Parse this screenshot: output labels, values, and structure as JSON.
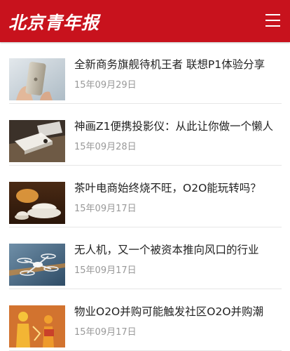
{
  "header": {
    "logo_text": "北京青年报",
    "menu_icon": "hamburger-menu-icon",
    "background_color": "#c8121d"
  },
  "articles": [
    {
      "title": "全新商务旗舰待机王者 联想P1体验分享",
      "date": "15年09月29日",
      "thumb": "phone-in-hand-image"
    },
    {
      "title": "神画Z1便携投影仪：从此让你做一个懒人",
      "date": "15年09月28日",
      "thumb": "projector-image"
    },
    {
      "title": "茶叶电商始终烧不旺，O2O能玩转吗？",
      "date": "15年09月17日",
      "thumb": "tea-image"
    },
    {
      "title": "无人机，又一个被资本推向风口的行业",
      "date": "15年09月17日",
      "thumb": "drone-image"
    },
    {
      "title": "物业O2O并购可能触发社区O2O并购潮",
      "date": "15年09月17日",
      "thumb": "o2o-figures-image"
    }
  ]
}
